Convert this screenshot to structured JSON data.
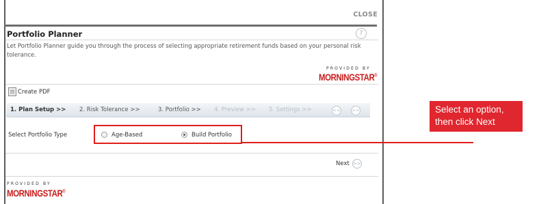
{
  "dialog": {
    "close_label": "CLOSE",
    "title": "Portfolio Planner",
    "help_glyph": "?",
    "description": "Let Portfolio Planner guide you through the process of selecting appropriate retirement funds based on your personal risk tolerance.",
    "provided_by": "PROVIDED BY",
    "brand": "MORNINGSTAR",
    "brand_mark": "®"
  },
  "toolbar": {
    "create_pdf_label": "Create PDF",
    "create_pdf_icon": "pdf-document-icon"
  },
  "steps": [
    {
      "label": "1. Plan Setup >>",
      "state": "active"
    },
    {
      "label": "2. Risk Tolerance >>",
      "state": "enabled"
    },
    {
      "label": "3. Portfolio >>",
      "state": "enabled"
    },
    {
      "label": "4. Preview >>",
      "state": "disabled"
    },
    {
      "label": "5. Settings >>",
      "state": "disabled"
    }
  ],
  "step_nav": {
    "prev_glyph": "<<",
    "next_glyph": ">>"
  },
  "portfolio_type": {
    "label": "Select Portfolio Type",
    "options": [
      {
        "label": "Age-Based",
        "selected": false
      },
      {
        "label": "Build Portfolio",
        "selected": true
      }
    ]
  },
  "next": {
    "label": "Next",
    "glyph": ">>"
  },
  "callout": {
    "line1": "Select an option,",
    "line2": "then click Next"
  },
  "colors": {
    "accent_red": "#e01b1b",
    "callout_bg": "#e0262e",
    "brand_red": "#c81e1e"
  }
}
